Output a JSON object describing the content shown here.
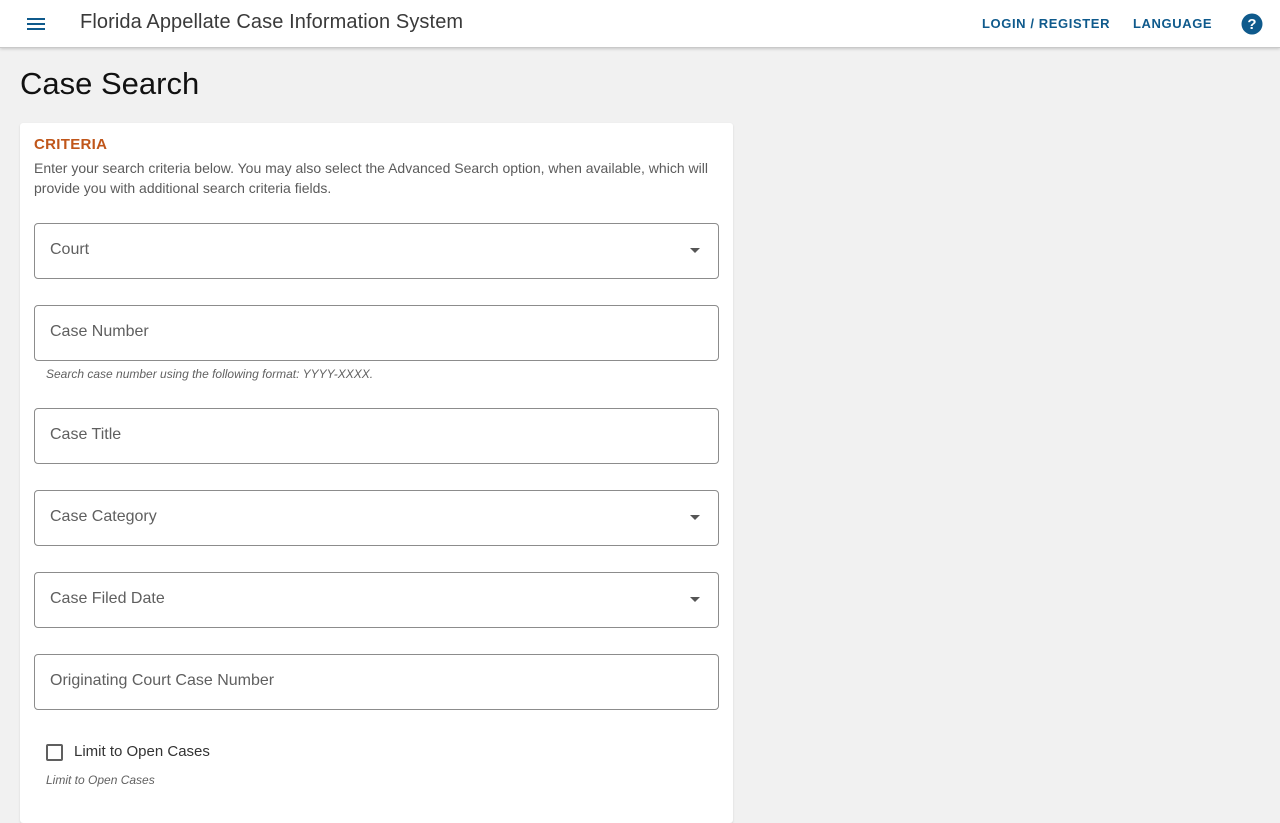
{
  "header": {
    "menu_icon": "hamburger-menu-icon",
    "app_title": "Florida Appellate Case Information System",
    "login_label": "LOGIN / REGISTER",
    "language_label": "LANGUAGE",
    "help_icon": "help-circle-icon"
  },
  "page": {
    "title": "Case Search"
  },
  "criteria": {
    "heading": "CRITERIA",
    "description": "Enter your search criteria below. You may also select the Advanced Search option, when available, which will provide you with additional search criteria fields."
  },
  "form": {
    "court_label": "Court",
    "case_number_label": "Case Number",
    "case_number_hint": "Search case number using the following format: YYYY-XXXX.",
    "case_title_label": "Case Title",
    "case_category_label": "Case Category",
    "case_filed_date_label": "Case Filed Date",
    "originating_case_number_label": "Originating Court Case Number",
    "limit_open_label": "Limit to Open Cases",
    "limit_open_hint": "Limit to Open Cases",
    "limit_open_checked": false
  },
  "colors": {
    "accent_orange": "#c0561a",
    "link_blue": "#0f5a8c",
    "background": "#f1f1f1"
  }
}
